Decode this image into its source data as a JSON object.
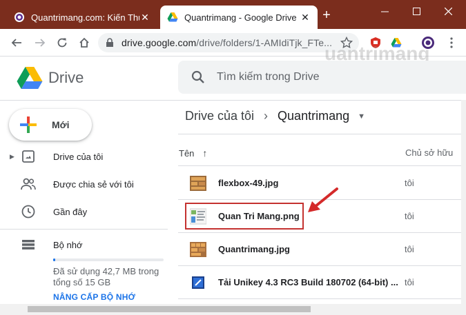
{
  "browser": {
    "tabs": [
      {
        "title": "Quantrimang.com: Kiến Thức",
        "active": false
      },
      {
        "title": "Quantrimang - Google Drive",
        "active": true
      }
    ],
    "url_host": "drive.google.com",
    "url_path": "/drive/folders/1-AMIdiTjk_FTe..."
  },
  "drive": {
    "brand": "Drive",
    "search_placeholder": "Tìm kiếm trong Drive"
  },
  "sidebar": {
    "new_label": "Mới",
    "items": [
      {
        "label": "Drive của tôi",
        "icon": "my-drive-icon"
      },
      {
        "label": "Được chia sẻ với tôi",
        "icon": "shared-icon"
      },
      {
        "label": "Gần đây",
        "icon": "clock-icon"
      },
      {
        "label": "Bộ nhớ",
        "icon": "storage-icon"
      }
    ],
    "storage_text": "Đã sử dụng 42,7 MB trong tổng số 15 GB",
    "storage_used_fraction": 0.003,
    "upgrade_label": "NÂNG CẤP BỘ NHỚ"
  },
  "breadcrumb": {
    "root": "Drive của tôi",
    "current": "Quantrimang"
  },
  "file_list": {
    "col_name": "Tên",
    "col_owner": "Chủ sở hữu",
    "files": [
      {
        "name": "flexbox-49.jpg",
        "owner": "tôi",
        "icon": "image-icon"
      },
      {
        "name": "Quan Tri Mang.png",
        "owner": "tôi",
        "icon": "image-icon",
        "highlighted": true
      },
      {
        "name": "Quantrimang.jpg",
        "owner": "tôi",
        "icon": "image-icon"
      },
      {
        "name": "Tải Unikey 4.3 RC3 Build 180702 (64-bit) ...",
        "owner": "tôi",
        "icon": "unikey-icon"
      }
    ]
  },
  "watermark": "uantrimang",
  "colors": {
    "tabbar": "#7b2d1d",
    "accent": "#1a73e8",
    "highlight": "#c4312f"
  }
}
